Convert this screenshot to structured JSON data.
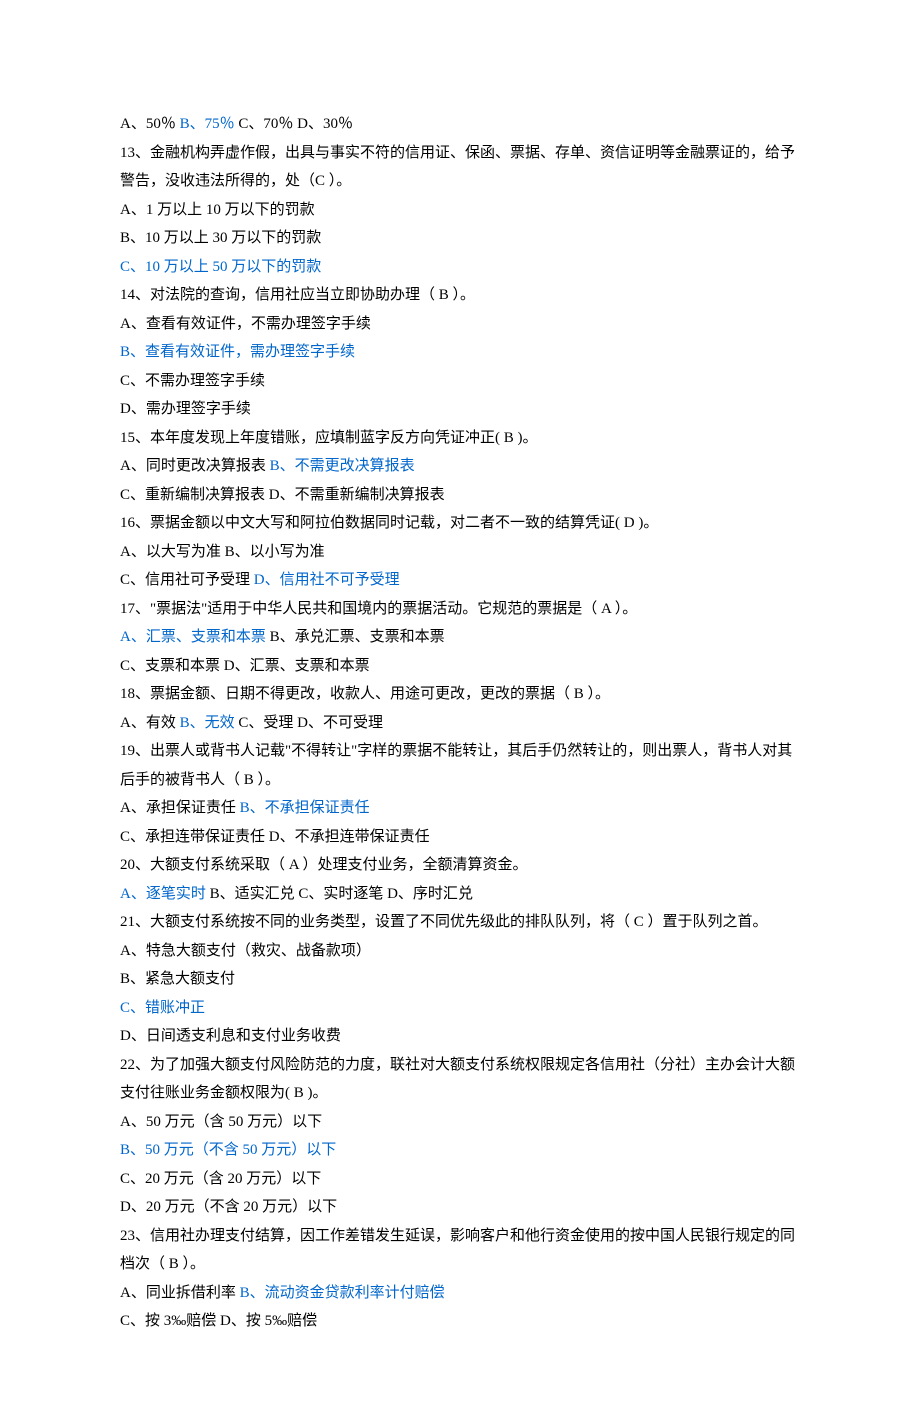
{
  "lines": [
    [
      {
        "text": "A、50％ ",
        "blue": false
      },
      {
        "text": "B、75％",
        "blue": true
      },
      {
        "text": " C、70％ D、30％",
        "blue": false
      }
    ],
    [
      {
        "text": "13、金融机构弄虚作假，出具与事实不符的信用证、保函、票据、存单、资信证明等金融票证的，给予警告，没收违法所得的，处（C ）。",
        "blue": false
      }
    ],
    [
      {
        "text": "A、1 万以上 10 万以下的罚款",
        "blue": false
      }
    ],
    [
      {
        "text": "B、10 万以上 30 万以下的罚款",
        "blue": false
      }
    ],
    [
      {
        "text": "C、10 万以上 50 万以下的罚款",
        "blue": true
      }
    ],
    [
      {
        "text": "14、对法院的查询，信用社应当立即协助办理（ B ）。",
        "blue": false
      }
    ],
    [
      {
        "text": "A、查看有效证件，不需办理签字手续",
        "blue": false
      }
    ],
    [
      {
        "text": "B、查看有效证件，需办理签字手续",
        "blue": true
      }
    ],
    [
      {
        "text": "C、不需办理签字手续",
        "blue": false
      }
    ],
    [
      {
        "text": "D、需办理签字手续",
        "blue": false
      }
    ],
    [
      {
        "text": "15、本年度发现上年度错账，应填制蓝字反方向凭证冲正( B )。",
        "blue": false
      }
    ],
    [
      {
        "text": "A、同时更改决算报表 ",
        "blue": false
      },
      {
        "text": "B、不需更改决算报表",
        "blue": true
      }
    ],
    [
      {
        "text": "C、重新编制决算报表 D、不需重新编制决算报表",
        "blue": false
      }
    ],
    [
      {
        "text": "16、票据金额以中文大写和阿拉伯数据同时记载，对二者不一致的结算凭证( D )。",
        "blue": false
      }
    ],
    [
      {
        "text": "A、以大写为准 B、以小写为准",
        "blue": false
      }
    ],
    [
      {
        "text": "C、信用社可予受理 ",
        "blue": false
      },
      {
        "text": "D、信用社不可予受理",
        "blue": true
      }
    ],
    [
      {
        "text": "17、\"票据法\"适用于中华人民共和国境内的票据活动。它规范的票据是（ A ）。",
        "blue": false
      }
    ],
    [
      {
        "text": "A、汇票、支票和本票",
        "blue": true
      },
      {
        "text": " B、承兑汇票、支票和本票",
        "blue": false
      }
    ],
    [
      {
        "text": "C、支票和本票 D、汇票、支票和本票",
        "blue": false
      }
    ],
    [
      {
        "text": "18、票据金额、日期不得更改，收款人、用途可更改，更改的票据（ B ）。",
        "blue": false
      }
    ],
    [
      {
        "text": "A、有效 ",
        "blue": false
      },
      {
        "text": "B、无效",
        "blue": true
      },
      {
        "text": " C、受理 D、不可受理",
        "blue": false
      }
    ],
    [
      {
        "text": "19、出票人或背书人记载\"不得转让\"字样的票据不能转让，其后手仍然转让的，则出票人，背书人对其后手的被背书人（ B ）。",
        "blue": false
      }
    ],
    [
      {
        "text": "A、承担保证责任 ",
        "blue": false
      },
      {
        "text": "B、不承担保证责任",
        "blue": true
      }
    ],
    [
      {
        "text": "C、承担连带保证责任 D、不承担连带保证责任",
        "blue": false
      }
    ],
    [
      {
        "text": "20、大额支付系统采取（ A ）处理支付业务，全额清算资金。",
        "blue": false
      }
    ],
    [
      {
        "text": "A、逐笔实时",
        "blue": true
      },
      {
        "text": " B、适实汇兑 C、实时逐笔 D、序时汇兑",
        "blue": false
      }
    ],
    [
      {
        "text": "21、大额支付系统按不同的业务类型，设置了不同优先级此的排队队列，将（ C ）置于队列之首。",
        "blue": false
      }
    ],
    [
      {
        "text": "A、特急大额支付（救灾、战备款项）",
        "blue": false
      }
    ],
    [
      {
        "text": "B、紧急大额支付",
        "blue": false
      }
    ],
    [
      {
        "text": "C、错账冲正",
        "blue": true
      }
    ],
    [
      {
        "text": "D、日间透支利息和支付业务收费",
        "blue": false
      }
    ],
    [
      {
        "text": "22、为了加强大额支付风险防范的力度，联社对大额支付系统权限规定各信用社（分社）主办会计大额支付往账业务金额权限为( B )。",
        "blue": false
      }
    ],
    [
      {
        "text": "A、50 万元（含 50 万元）以下",
        "blue": false
      }
    ],
    [
      {
        "text": "B、50 万元（不含 50 万元）以下",
        "blue": true
      }
    ],
    [
      {
        "text": "C、20 万元（含 20 万元）以下",
        "blue": false
      }
    ],
    [
      {
        "text": "D、20 万元（不含 20 万元）以下",
        "blue": false
      }
    ],
    [
      {
        "text": "23、信用社办理支付结算，因工作差错发生延误，影响客户和他行资金使用的按中国人民银行规定的同档次（ B ）。",
        "blue": false
      }
    ],
    [
      {
        "text": "A、同业拆借利率 ",
        "blue": false
      },
      {
        "text": "B、流动资金贷款利率计付赔偿",
        "blue": true
      }
    ],
    [
      {
        "text": "C、按 3‰赔偿 D、按 5‰赔偿",
        "blue": false
      }
    ]
  ]
}
